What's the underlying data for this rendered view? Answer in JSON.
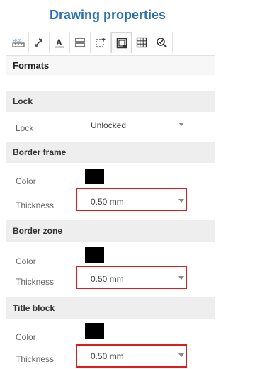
{
  "panel": {
    "title": "Drawing properties"
  },
  "toolbar": {
    "tools": [
      {
        "name": "units-precision-icon"
      },
      {
        "name": "dimension-arrow-icon"
      },
      {
        "name": "text-underline-icon"
      },
      {
        "name": "layers-icon"
      },
      {
        "name": "datum-icon"
      },
      {
        "name": "border-format-icon"
      },
      {
        "name": "grid-table-icon"
      },
      {
        "name": "check-tool-icon"
      }
    ]
  },
  "formats": {
    "label": "Formats"
  },
  "lock_section": {
    "header": "Lock",
    "lock_label": "Lock",
    "lock_value": "Unlocked"
  },
  "border_frame": {
    "header": "Border frame",
    "color_label": "Color",
    "color": "#000000",
    "thickness_label": "Thickness",
    "thickness_value": "0.50 mm"
  },
  "border_zone": {
    "header": "Border zone",
    "color_label": "Color",
    "color": "#000000",
    "thickness_label": "Thickness",
    "thickness_value": "0.50 mm"
  },
  "title_block": {
    "header": "Title block",
    "color_label": "Color",
    "color": "#000000",
    "thickness_label": "Thickness",
    "thickness_value": "0.50 mm"
  },
  "accent_colors": {
    "title": "#2b6fb3",
    "highlight": "#e01b1b"
  }
}
